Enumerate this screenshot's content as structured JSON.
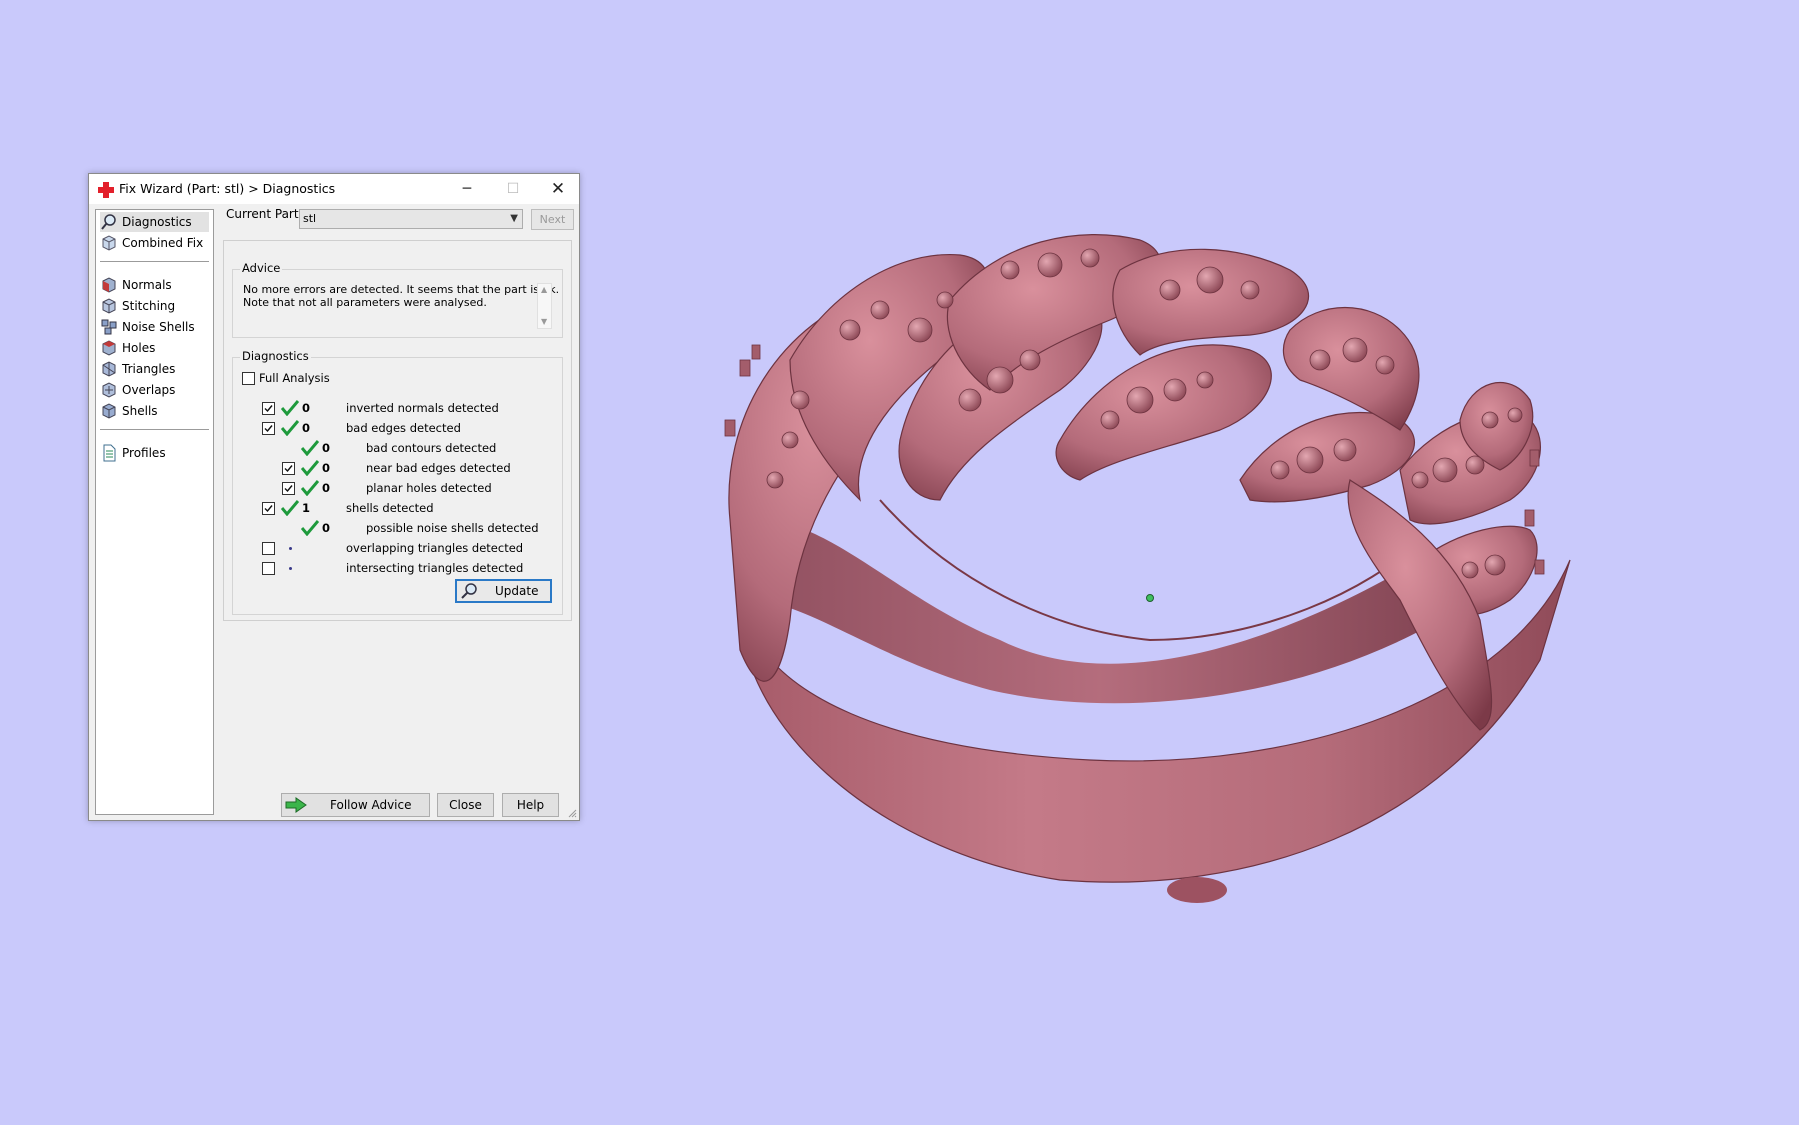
{
  "colors": {
    "background": "#c9c9fb",
    "model": "#b46b7a",
    "accent": "#2a79c7",
    "tick": "#1e9a3c"
  },
  "window": {
    "title": "Fix Wizard (Part: stl) > Diagnostics",
    "app_icon": "red-cross-icon",
    "minimize_icon": "minimize-icon",
    "maximize_icon": "maximize-icon",
    "close_icon": "close-icon"
  },
  "sidebar": {
    "items": [
      {
        "label": "Diagnostics",
        "icon": "magnifier-icon"
      },
      {
        "label": "Combined Fix",
        "icon": "cube-icon"
      },
      {
        "label": "Normals",
        "icon": "normals-cube-icon"
      },
      {
        "label": "Stitching",
        "icon": "stitching-cube-icon"
      },
      {
        "label": "Noise Shells",
        "icon": "noise-shells-icon"
      },
      {
        "label": "Holes",
        "icon": "holes-cube-icon"
      },
      {
        "label": "Triangles",
        "icon": "triangles-cube-icon"
      },
      {
        "label": "Overlaps",
        "icon": "overlaps-cube-icon"
      },
      {
        "label": "Shells",
        "icon": "shells-cube-icon"
      },
      {
        "label": "Profiles",
        "icon": "document-icon"
      }
    ]
  },
  "current_part": {
    "label": "Current Part:",
    "value": "stl",
    "next_label": "Next"
  },
  "advice": {
    "heading": "Advice",
    "line1": "No more errors are detected. It seems that the part is ok.",
    "line2": "Note that not all parameters were analysed."
  },
  "diagnostics": {
    "heading": "Diagnostics",
    "full_analysis_label": "Full Analysis",
    "full_analysis_checked": false,
    "rows": [
      {
        "checkbox": true,
        "checked": true,
        "status": "ok",
        "count": "0",
        "label": "inverted normals detected",
        "indent": 0
      },
      {
        "checkbox": true,
        "checked": true,
        "status": "ok",
        "count": "0",
        "label": "bad edges detected",
        "indent": 0
      },
      {
        "checkbox": false,
        "checked": false,
        "status": "ok",
        "count": "0",
        "label": "bad contours detected",
        "indent": 1
      },
      {
        "checkbox": true,
        "checked": true,
        "status": "ok",
        "count": "0",
        "label": "near bad edges detected",
        "indent": 1
      },
      {
        "checkbox": true,
        "checked": true,
        "status": "ok",
        "count": "0",
        "label": "planar holes detected",
        "indent": 1
      },
      {
        "checkbox": true,
        "checked": true,
        "status": "ok",
        "count": "1",
        "label": "shells detected",
        "indent": 0
      },
      {
        "checkbox": false,
        "checked": false,
        "status": "ok",
        "count": "0",
        "label": "possible noise shells detected",
        "indent": 1
      },
      {
        "checkbox": true,
        "checked": false,
        "status": "pending",
        "count": "",
        "label": "overlapping triangles detected",
        "indent": 0
      },
      {
        "checkbox": true,
        "checked": false,
        "status": "pending",
        "count": "",
        "label": "intersecting triangles detected",
        "indent": 0
      }
    ],
    "update_label": "Update",
    "update_icon": "magnifier-icon"
  },
  "footer": {
    "follow_advice_label": "Follow Advice",
    "follow_advice_icon": "green-arrow-icon",
    "close_label": "Close",
    "help_label": "Help"
  },
  "viewport": {
    "model": "ring-3d-model",
    "pivot": "rotation-center-marker"
  }
}
